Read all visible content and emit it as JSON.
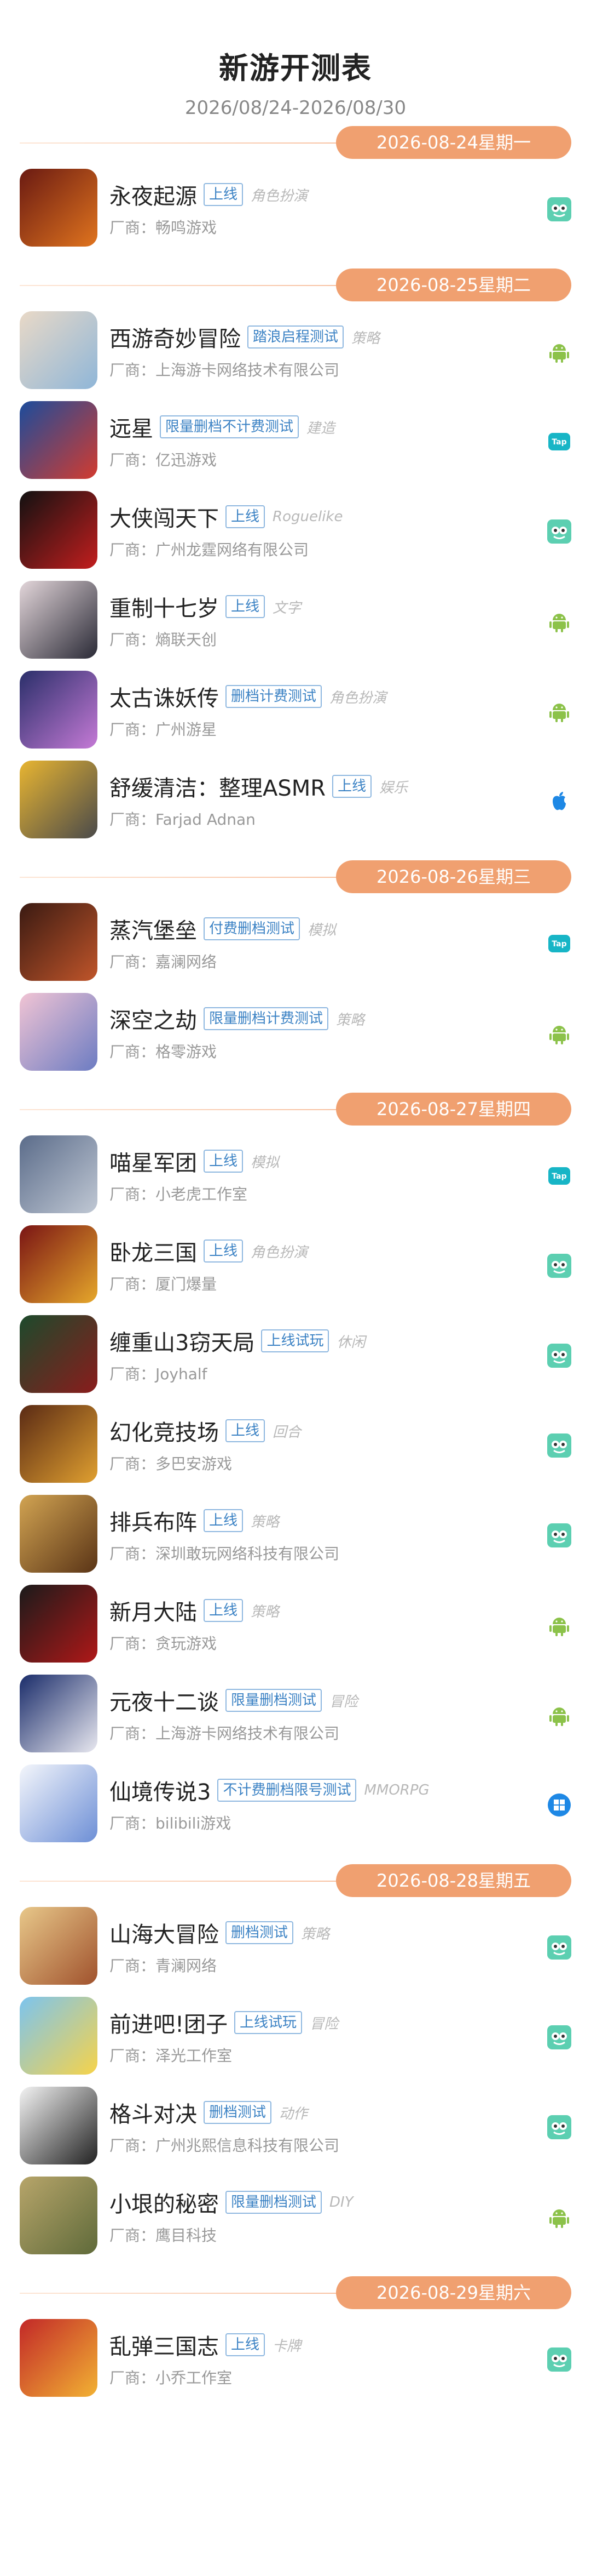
{
  "header": {
    "title": "新游开测表",
    "date_range": "2026/08/24-2026/08/30"
  },
  "publisher_prefix": "厂商：",
  "days": [
    {
      "label": "2026-08-24星期一",
      "games": [
        {
          "name": "永夜起源",
          "status": "上线",
          "genre": "角色扮演",
          "publisher": "畅鸣游戏",
          "platform": "taptap-icon",
          "colors": [
            "#6a1a12",
            "#e0741e"
          ]
        }
      ]
    },
    {
      "label": "2026-08-25星期二",
      "games": [
        {
          "name": "西游奇妙冒险",
          "status": "踏浪启程测试",
          "genre": "策略",
          "publisher": "上海游卡网络技术有限公司",
          "platform": "android-icon",
          "colors": [
            "#e9d9c7",
            "#8fb6d8"
          ]
        },
        {
          "name": "远星",
          "status": "限量删档不计费测试",
          "genre": "建造",
          "publisher": "亿迅游戏",
          "platform": "tap-icon",
          "colors": [
            "#1b4c9c",
            "#d33b2f"
          ]
        },
        {
          "name": "大侠闯天下",
          "status": "上线",
          "genre": "Roguelike",
          "publisher": "广州龙霆网络有限公司",
          "platform": "taptap-icon",
          "colors": [
            "#111111",
            "#c31e1e"
          ]
        },
        {
          "name": "重制十七岁",
          "status": "上线",
          "genre": "文字",
          "publisher": "熵联天创",
          "platform": "android-icon",
          "colors": [
            "#e3d6da",
            "#2a2a36"
          ]
        },
        {
          "name": "太古诛妖传",
          "status": "删档计费测试",
          "genre": "角色扮演",
          "publisher": "广州游星",
          "platform": "android-icon",
          "colors": [
            "#2a2f6a",
            "#c57ad6"
          ]
        },
        {
          "name": "舒缓清洁：整理ASMR",
          "status": "上线",
          "genre": "娱乐",
          "publisher": "Farjad Adnan",
          "platform": "apple-icon",
          "colors": [
            "#e8b531",
            "#4a4a4a"
          ]
        }
      ]
    },
    {
      "label": "2026-08-26星期三",
      "games": [
        {
          "name": "蒸汽堡垒",
          "status": "付费删档测试",
          "genre": "模拟",
          "publisher": "嘉澜网络",
          "platform": "tap-icon",
          "colors": [
            "#3a1a12",
            "#c0552a"
          ]
        },
        {
          "name": "深空之劫",
          "status": "限量删档计费测试",
          "genre": "策略",
          "publisher": "格零游戏",
          "platform": "android-icon",
          "colors": [
            "#f1c4d4",
            "#6c7cc2"
          ]
        }
      ]
    },
    {
      "label": "2026-08-27星期四",
      "games": [
        {
          "name": "喵星军团",
          "status": "上线",
          "genre": "模拟",
          "publisher": "小老虎工作室",
          "platform": "tap-icon",
          "colors": [
            "#5b6c8a",
            "#c0c8d4"
          ]
        },
        {
          "name": "卧龙三国",
          "status": "上线",
          "genre": "角色扮演",
          "publisher": "厦门爆量",
          "platform": "taptap-icon",
          "colors": [
            "#7a1414",
            "#e6a82b"
          ]
        },
        {
          "name": "缠重山3窃天局",
          "status": "上线试玩",
          "genre": "休闲",
          "publisher": "Joyhalf",
          "platform": "taptap-icon",
          "colors": [
            "#1c4a2c",
            "#8a1c1c"
          ]
        },
        {
          "name": "幻化竞技场",
          "status": "上线",
          "genre": "回合",
          "publisher": "多巴安游戏",
          "platform": "taptap-icon",
          "colors": [
            "#5a2a14",
            "#e0a030"
          ]
        },
        {
          "name": "排兵布阵",
          "status": "上线",
          "genre": "策略",
          "publisher": "深圳敢玩网络科技有限公司",
          "platform": "taptap-icon",
          "colors": [
            "#d2a452",
            "#5a3416"
          ]
        },
        {
          "name": "新月大陆",
          "status": "上线",
          "genre": "策略",
          "publisher": "贪玩游戏",
          "platform": "android-icon",
          "colors": [
            "#1a1a1a",
            "#b01818"
          ]
        },
        {
          "name": "元夜十二谈",
          "status": "限量删档测试",
          "genre": "冒险",
          "publisher": "上海游卡网络技术有限公司",
          "platform": "android-icon",
          "colors": [
            "#1a2c6a",
            "#e8e8f0"
          ]
        },
        {
          "name": "仙境传说3",
          "status": "不计费删档限号测试",
          "genre": "MMORPG",
          "publisher": "bilibili游戏",
          "platform": "windows-icon",
          "colors": [
            "#f4f6fb",
            "#6d8fd6"
          ]
        }
      ]
    },
    {
      "label": "2026-08-28星期五",
      "games": [
        {
          "name": "山海大冒险",
          "status": "删档测试",
          "genre": "策略",
          "publisher": "青澜网络",
          "platform": "taptap-icon",
          "colors": [
            "#e8c88a",
            "#a0522d"
          ]
        },
        {
          "name": "前进吧!团子",
          "status": "上线试玩",
          "genre": "冒险",
          "publisher": "泽光工作室",
          "platform": "taptap-icon",
          "colors": [
            "#7cc4ef",
            "#f6d34a"
          ]
        },
        {
          "name": "格斗对决",
          "status": "删档测试",
          "genre": "动作",
          "publisher": "广州兆熙信息科技有限公司",
          "platform": "taptap-icon",
          "colors": [
            "#f4f4f4",
            "#222222"
          ]
        },
        {
          "name": "小垠的秘密",
          "status": "限量删档测试",
          "genre": "DIY",
          "publisher": "鹰目科技",
          "platform": "android-icon",
          "colors": [
            "#b7a56a",
            "#5f6a3a"
          ]
        }
      ]
    },
    {
      "label": "2026-08-29星期六",
      "games": [
        {
          "name": "乱弹三国志",
          "status": "上线",
          "genre": "卡牌",
          "publisher": "小乔工作室",
          "platform": "taptap-icon",
          "colors": [
            "#c22828",
            "#f2b233"
          ]
        }
      ]
    }
  ]
}
